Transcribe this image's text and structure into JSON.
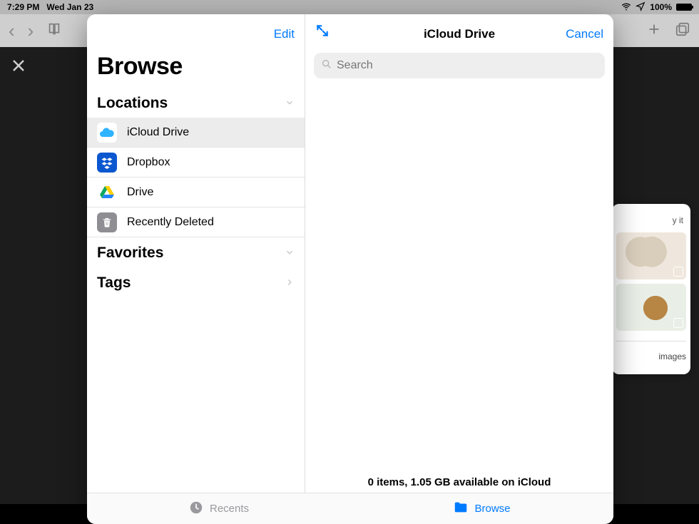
{
  "statusbar": {
    "time": "7:29 PM",
    "date": "Wed Jan 23",
    "battery": "100%"
  },
  "toolbar": {},
  "peek": {
    "hint": "y it",
    "footer": "images"
  },
  "sheet": {
    "left": {
      "edit": "Edit",
      "title": "Browse",
      "sections": {
        "locations": {
          "title": "Locations",
          "items": [
            {
              "label": "iCloud Drive",
              "selected": true,
              "icon": "icloud"
            },
            {
              "label": "Dropbox",
              "selected": false,
              "icon": "dropbox"
            },
            {
              "label": "Drive",
              "selected": false,
              "icon": "gdrive"
            },
            {
              "label": "Recently Deleted",
              "selected": false,
              "icon": "trash"
            }
          ]
        },
        "favorites": {
          "title": "Favorites"
        },
        "tags": {
          "title": "Tags"
        }
      }
    },
    "right": {
      "title": "iCloud Drive",
      "cancel": "Cancel",
      "search_placeholder": "Search",
      "status": "0 items, 1.05 GB available on iCloud"
    },
    "tabs": {
      "recents": "Recents",
      "browse": "Browse"
    }
  }
}
